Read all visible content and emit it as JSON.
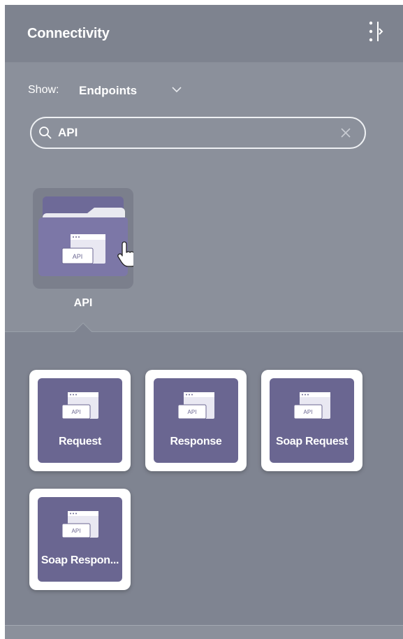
{
  "header": {
    "title": "Connectivity",
    "toggle_icon": "panel-toggle-icon"
  },
  "filter": {
    "show_label": "Show:",
    "show_value": "Endpoints"
  },
  "search": {
    "value": "API",
    "placeholder": ""
  },
  "folder": {
    "label": "API",
    "icon": "api-folder-icon"
  },
  "endpoints": [
    {
      "label": "Request"
    },
    {
      "label": "Response"
    },
    {
      "label": "Soap Request"
    },
    {
      "label": "Soap Respon..."
    }
  ],
  "colors": {
    "panel": "#8a8f9a",
    "header": "#7e838f",
    "tile_purple": "#6a6691",
    "folder_purple": "#7c77a7"
  }
}
